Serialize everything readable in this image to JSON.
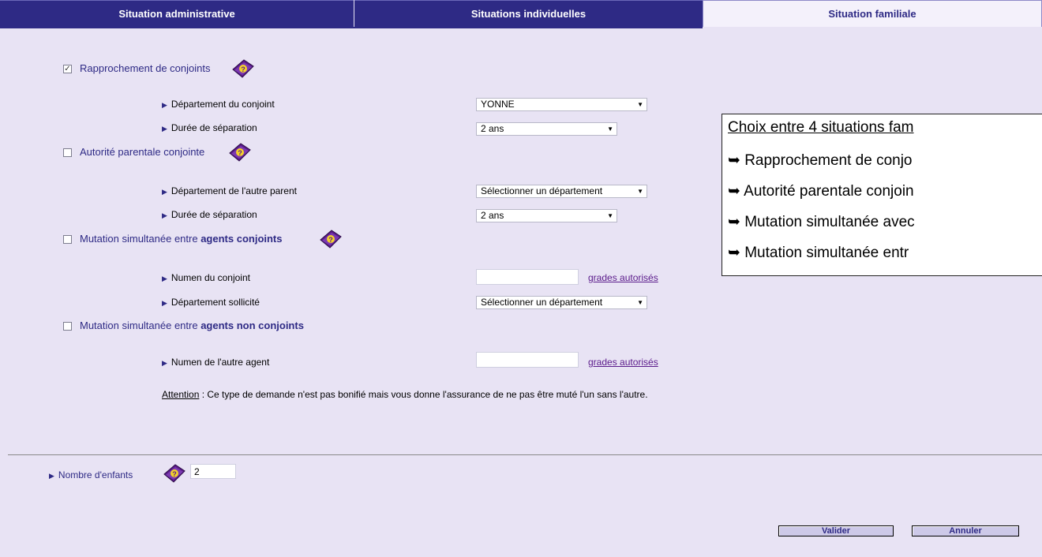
{
  "tabs": [
    {
      "label": "Situation administrative"
    },
    {
      "label": "Situations individuelles"
    },
    {
      "label": "Situation familiale"
    }
  ],
  "options": {
    "rapprochement": {
      "label": "Rapprochement de conjoints",
      "checked": true,
      "check_mark": "✓"
    },
    "autorite": {
      "label": "Autorité parentale conjointe"
    },
    "mutation_conjoints": {
      "label_prefix": "Mutation simultanée entre ",
      "label_bold": "agents conjoints"
    },
    "mutation_non_conjoints": {
      "label_prefix": "Mutation simultanée entre ",
      "label_bold": "agents non conjoints"
    }
  },
  "fields": {
    "dept_conjoint": {
      "label": "Département du conjoint",
      "value": "YONNE"
    },
    "duree_sep_1": {
      "label": "Durée de séparation",
      "value": "2 ans"
    },
    "dept_autre_parent": {
      "label": "Département de l'autre parent",
      "value": "Sélectionner un département"
    },
    "duree_sep_2": {
      "label": "Durée de séparation",
      "value": "2 ans"
    },
    "numen_conjoint": {
      "label": "Numen du conjoint",
      "value": "",
      "link": "grades autorisés"
    },
    "dept_sollicite": {
      "label": "Département sollicité",
      "value": "Sélectionner un département"
    },
    "numen_autre": {
      "label": "Numen de l'autre agent",
      "value": "",
      "link": "grades autorisés"
    }
  },
  "attention": {
    "label": "Attention",
    "text": " : Ce type de demande n'est pas bonifié mais vous donne l'assurance de ne pas être muté l'un sans l'autre."
  },
  "enfants": {
    "label": "Nombre d'enfants",
    "value": "2"
  },
  "buttons": {
    "valider": "Valider",
    "annuler": "Annuler"
  },
  "callout": {
    "title": "Choix entre 4 situations fam",
    "items": [
      "➥ Rapprochement de conjo",
      "➥ Autorité parentale conjoin",
      "➥ Mutation simultanée avec",
      "➥ Mutation simultanée entr"
    ]
  },
  "icons": {
    "arrow": "▶",
    "dropdown": "▼",
    "help": "help-book-icon"
  },
  "colors": {
    "tab_dark": "#2e2a85",
    "background": "#e8e3f4",
    "link": "#5a1a8a"
  }
}
